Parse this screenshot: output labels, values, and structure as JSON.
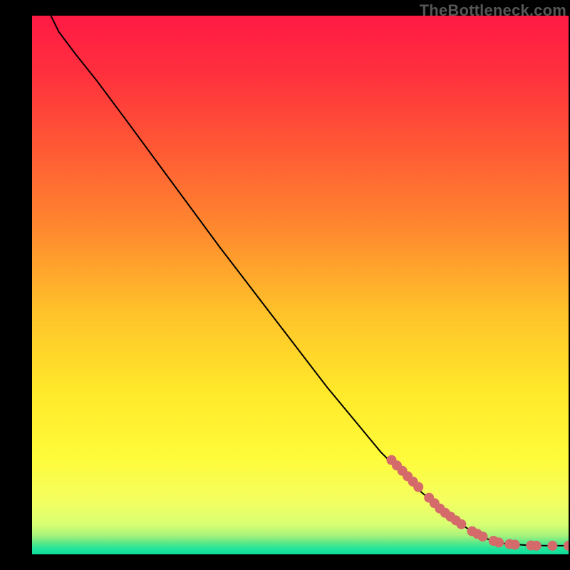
{
  "watermark": "TheBottleneck.com",
  "chart_data": {
    "type": "line",
    "title": "",
    "xlabel": "",
    "ylabel": "",
    "xlim": [
      0,
      100
    ],
    "ylim": [
      0,
      100
    ],
    "grid": false,
    "legend": false,
    "curve": [
      {
        "x": 3.5,
        "y": 100
      },
      {
        "x": 5,
        "y": 97
      },
      {
        "x": 8,
        "y": 93
      },
      {
        "x": 12,
        "y": 88
      },
      {
        "x": 18,
        "y": 80
      },
      {
        "x": 25,
        "y": 70.5
      },
      {
        "x": 35,
        "y": 57
      },
      {
        "x": 45,
        "y": 44
      },
      {
        "x": 55,
        "y": 31
      },
      {
        "x": 65,
        "y": 19
      },
      {
        "x": 72,
        "y": 12
      },
      {
        "x": 78,
        "y": 7
      },
      {
        "x": 82,
        "y": 4.2
      },
      {
        "x": 85,
        "y": 2.8
      },
      {
        "x": 88,
        "y": 2.0
      },
      {
        "x": 92,
        "y": 1.7
      },
      {
        "x": 96,
        "y": 1.6
      },
      {
        "x": 100,
        "y": 1.6
      }
    ],
    "markers": [
      {
        "x": 67,
        "y": 17.5
      },
      {
        "x": 68,
        "y": 16.5
      },
      {
        "x": 69,
        "y": 15.5
      },
      {
        "x": 70,
        "y": 14.5
      },
      {
        "x": 71,
        "y": 13.5
      },
      {
        "x": 72,
        "y": 12.5
      },
      {
        "x": 74,
        "y": 10.5
      },
      {
        "x": 75,
        "y": 9.5
      },
      {
        "x": 76,
        "y": 8.5
      },
      {
        "x": 77,
        "y": 7.7
      },
      {
        "x": 78,
        "y": 7.0
      },
      {
        "x": 79,
        "y": 6.3
      },
      {
        "x": 80,
        "y": 5.6
      },
      {
        "x": 82,
        "y": 4.3
      },
      {
        "x": 83,
        "y": 3.8
      },
      {
        "x": 84,
        "y": 3.3
      },
      {
        "x": 86,
        "y": 2.5
      },
      {
        "x": 87,
        "y": 2.2
      },
      {
        "x": 89,
        "y": 1.9
      },
      {
        "x": 90,
        "y": 1.8
      },
      {
        "x": 93,
        "y": 1.65
      },
      {
        "x": 94,
        "y": 1.6
      },
      {
        "x": 97,
        "y": 1.6
      },
      {
        "x": 100,
        "y": 1.6
      }
    ],
    "marker_color": "#d46a6a",
    "line_color": "#000000",
    "gradient_stops": [
      {
        "offset": 0.0,
        "color": "#ff1a44"
      },
      {
        "offset": 0.1,
        "color": "#ff2e3e"
      },
      {
        "offset": 0.25,
        "color": "#ff5a34"
      },
      {
        "offset": 0.4,
        "color": "#ff8a2e"
      },
      {
        "offset": 0.55,
        "color": "#ffc22a"
      },
      {
        "offset": 0.7,
        "color": "#ffe92a"
      },
      {
        "offset": 0.82,
        "color": "#fffb3a"
      },
      {
        "offset": 0.9,
        "color": "#f4ff60"
      },
      {
        "offset": 0.945,
        "color": "#d8ff73"
      },
      {
        "offset": 0.965,
        "color": "#a7f27a"
      },
      {
        "offset": 0.978,
        "color": "#5fe888"
      },
      {
        "offset": 0.99,
        "color": "#1fe49a"
      },
      {
        "offset": 1.0,
        "color": "#0fdf9a"
      }
    ]
  }
}
